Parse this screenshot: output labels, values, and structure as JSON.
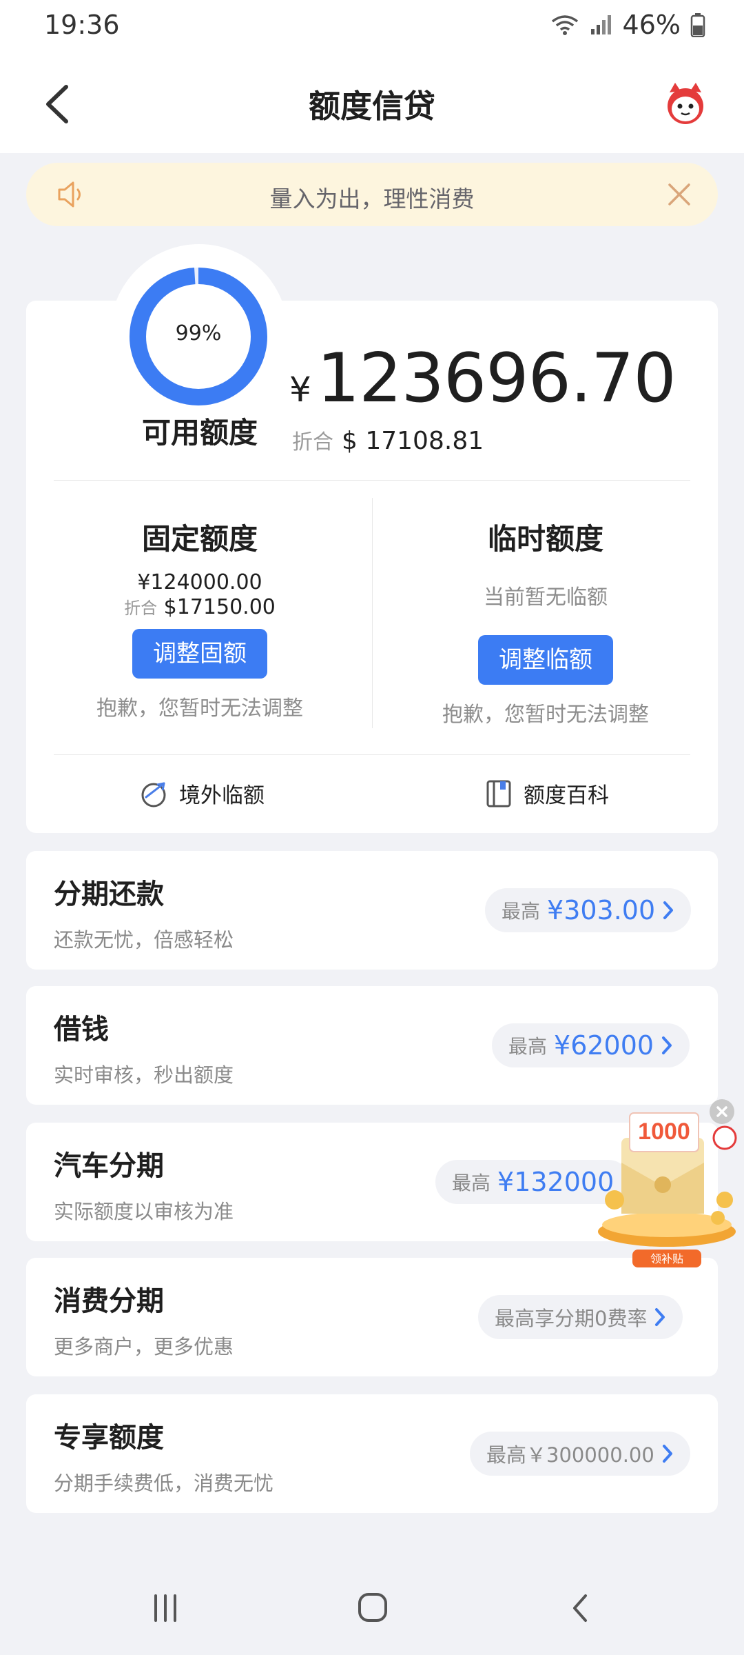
{
  "status_bar": {
    "time": "19:36",
    "battery": "46%"
  },
  "header": {
    "title": "额度信贷"
  },
  "notice": {
    "text": "量入为出，理性消费"
  },
  "credit": {
    "ring_percent_label": "99%",
    "ring_percent": 0.99,
    "available_label": "可用额度",
    "currency_symbol": "¥",
    "available_amount": "123696.70",
    "equiv_label": "折合",
    "equiv_amount": "$ 17108.81"
  },
  "fixed_quota": {
    "title": "固定额度",
    "amount": "¥124000.00",
    "equiv_label": "折合",
    "equiv_amount": "$17150.00",
    "button": "调整固额",
    "note": "抱歉，您暂时无法调整"
  },
  "temp_quota": {
    "title": "临时额度",
    "status": "当前暂无临额",
    "button": "调整临额",
    "note": "抱歉，您暂时无法调整"
  },
  "links": {
    "overseas": "境外临额",
    "wiki": "额度百科"
  },
  "products": [
    {
      "title": "分期还款",
      "subtitle": "还款无忧，倍感轻松",
      "pill_label": "最高",
      "pill_value": "¥303.00"
    },
    {
      "title": "借钱",
      "subtitle": "实时审核，秒出额度",
      "pill_label": "最高",
      "pill_value": "¥62000"
    },
    {
      "title": "汽车分期",
      "subtitle": "实际额度以审核为准",
      "pill_label": "最高",
      "pill_value": "¥132000"
    },
    {
      "title": "消费分期",
      "subtitle": "更多商户，更多优惠",
      "pill_text": "最高享分期0费率"
    },
    {
      "title": "专享额度",
      "subtitle": "分期手续费低，消费无忧",
      "pill_text": "最高￥300000.00"
    }
  ],
  "promo": {
    "amount": "1000",
    "label": "领补贴"
  },
  "colors": {
    "accent": "#3c7cf3",
    "page_bg": "#f1f2f6",
    "notice_bg": "#fdf5de",
    "promo": "#f26a2a"
  }
}
